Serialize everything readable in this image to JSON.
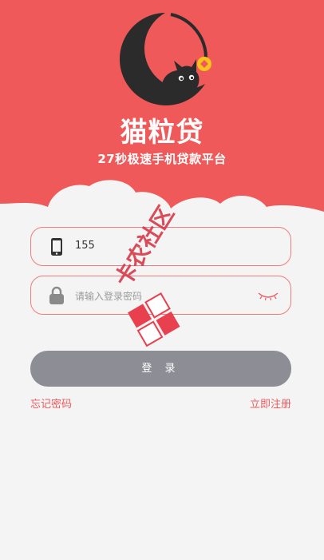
{
  "app": {
    "title": "猫粒贷",
    "tagline": "27秒极速手机贷款平台"
  },
  "login": {
    "phone_value": "155",
    "password_placeholder": "请输入登录密码",
    "login_label": "登 录",
    "forgot_label": "忘记密码",
    "register_label": "立即注册"
  },
  "watermark": {
    "text": "卡农社区"
  },
  "colors": {
    "brand_red": "#f0595a",
    "button_gray": "#8d8d96",
    "link_red": "#f05a5b",
    "field_border": "#f07c7d"
  },
  "icons": [
    "cat-logo-icon",
    "coin-icon",
    "phone-icon",
    "lock-icon",
    "eye-closed-icon"
  ]
}
